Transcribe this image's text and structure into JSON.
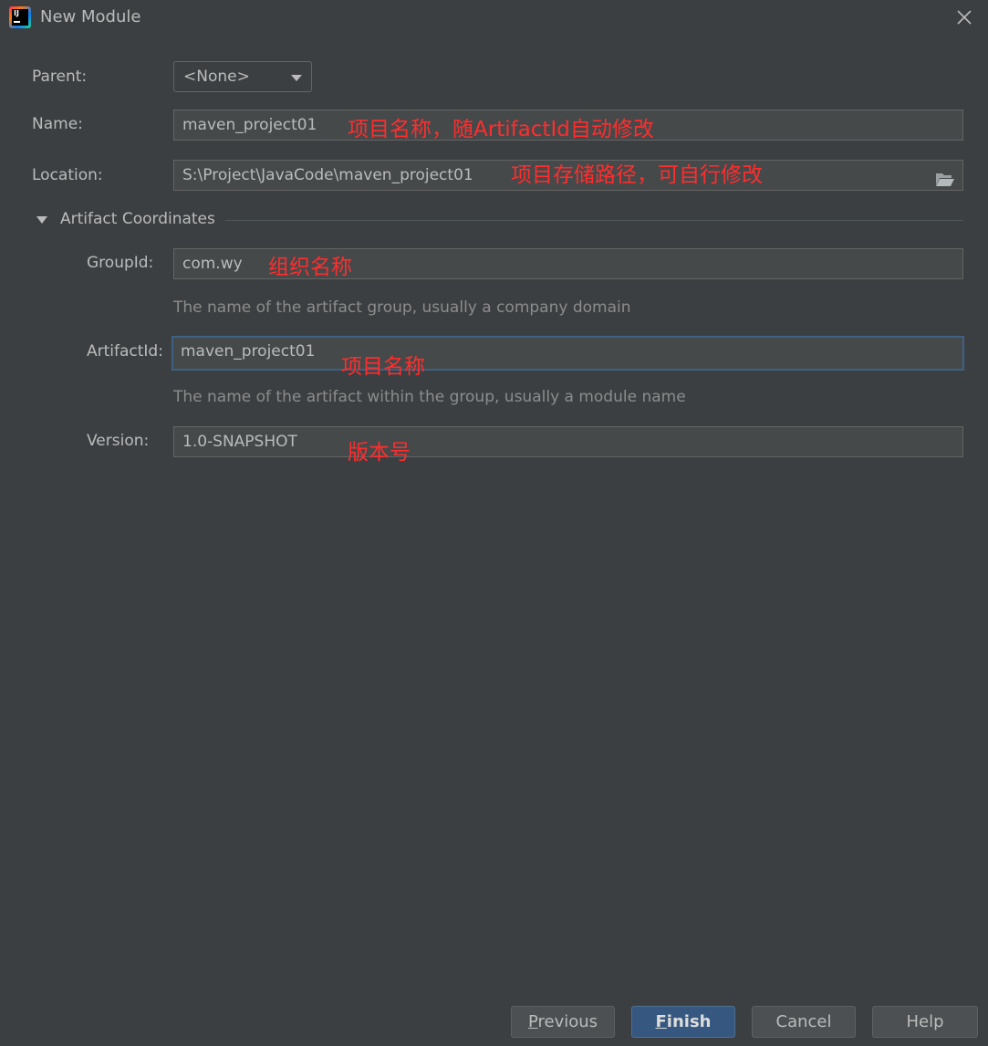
{
  "window": {
    "title": "New Module"
  },
  "form": {
    "parent": {
      "label": "Parent:",
      "value": "<None>"
    },
    "name": {
      "label": "Name:",
      "value": "maven_project01",
      "annotation": "项目名称，随ArtifactId自动修改"
    },
    "location": {
      "label": "Location:",
      "value": "S:\\Project\\JavaCode\\maven_project01",
      "annotation": "项目存储路径，可自行修改"
    }
  },
  "artifact": {
    "section_title": "Artifact Coordinates",
    "group_id": {
      "label": "GroupId:",
      "value": "com.wy",
      "annotation": "组织名称",
      "hint": "The name of the artifact group, usually a company domain"
    },
    "artifact_id": {
      "label": "ArtifactId:",
      "value": "maven_project01",
      "annotation": "项目名称",
      "hint": "The name of the artifact within the group, usually a module name"
    },
    "version": {
      "label": "Version:",
      "value": "1.0-SNAPSHOT",
      "annotation": "版本号"
    }
  },
  "buttons": {
    "previous": {
      "mnemonic": "P",
      "rest": "revious"
    },
    "finish": {
      "mnemonic": "F",
      "rest": "inish"
    },
    "cancel": "Cancel",
    "help": "Help"
  },
  "icons": {
    "app": "intellij-idea-icon",
    "close": "close-icon",
    "combo": "chevron-down-icon",
    "browse": "folder-icon",
    "section": "triangle-down-icon"
  },
  "colors": {
    "background": "#3c3f41",
    "field_bg": "#45494a",
    "focus_border": "#3d6185",
    "annotation": "#ff2d2d",
    "primary_button": "#365880"
  }
}
